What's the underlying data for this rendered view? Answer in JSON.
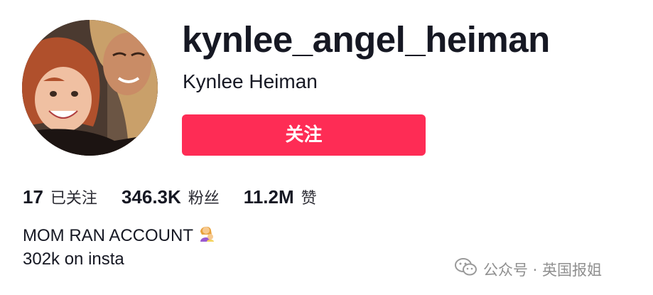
{
  "profile": {
    "username": "kynlee_angel_heiman",
    "nickname": "Kynlee Heiman",
    "follow_label": "关注"
  },
  "stats": [
    {
      "value": "17",
      "label": "已关注"
    },
    {
      "value": "346.3K",
      "label": "粉丝"
    },
    {
      "value": "11.2M",
      "label": "赞"
    }
  ],
  "bio": {
    "line1": "MOM RAN ACCOUNT",
    "line1_emoji": "woman-with-baby-emoji",
    "line2": "302k on insta"
  },
  "watermark": {
    "text": "公众号 · 英国报姐",
    "icon": "wechat-icon"
  },
  "colors": {
    "accent": "#fe2c55",
    "text": "#161823",
    "watermark": "#8f8f8f"
  }
}
